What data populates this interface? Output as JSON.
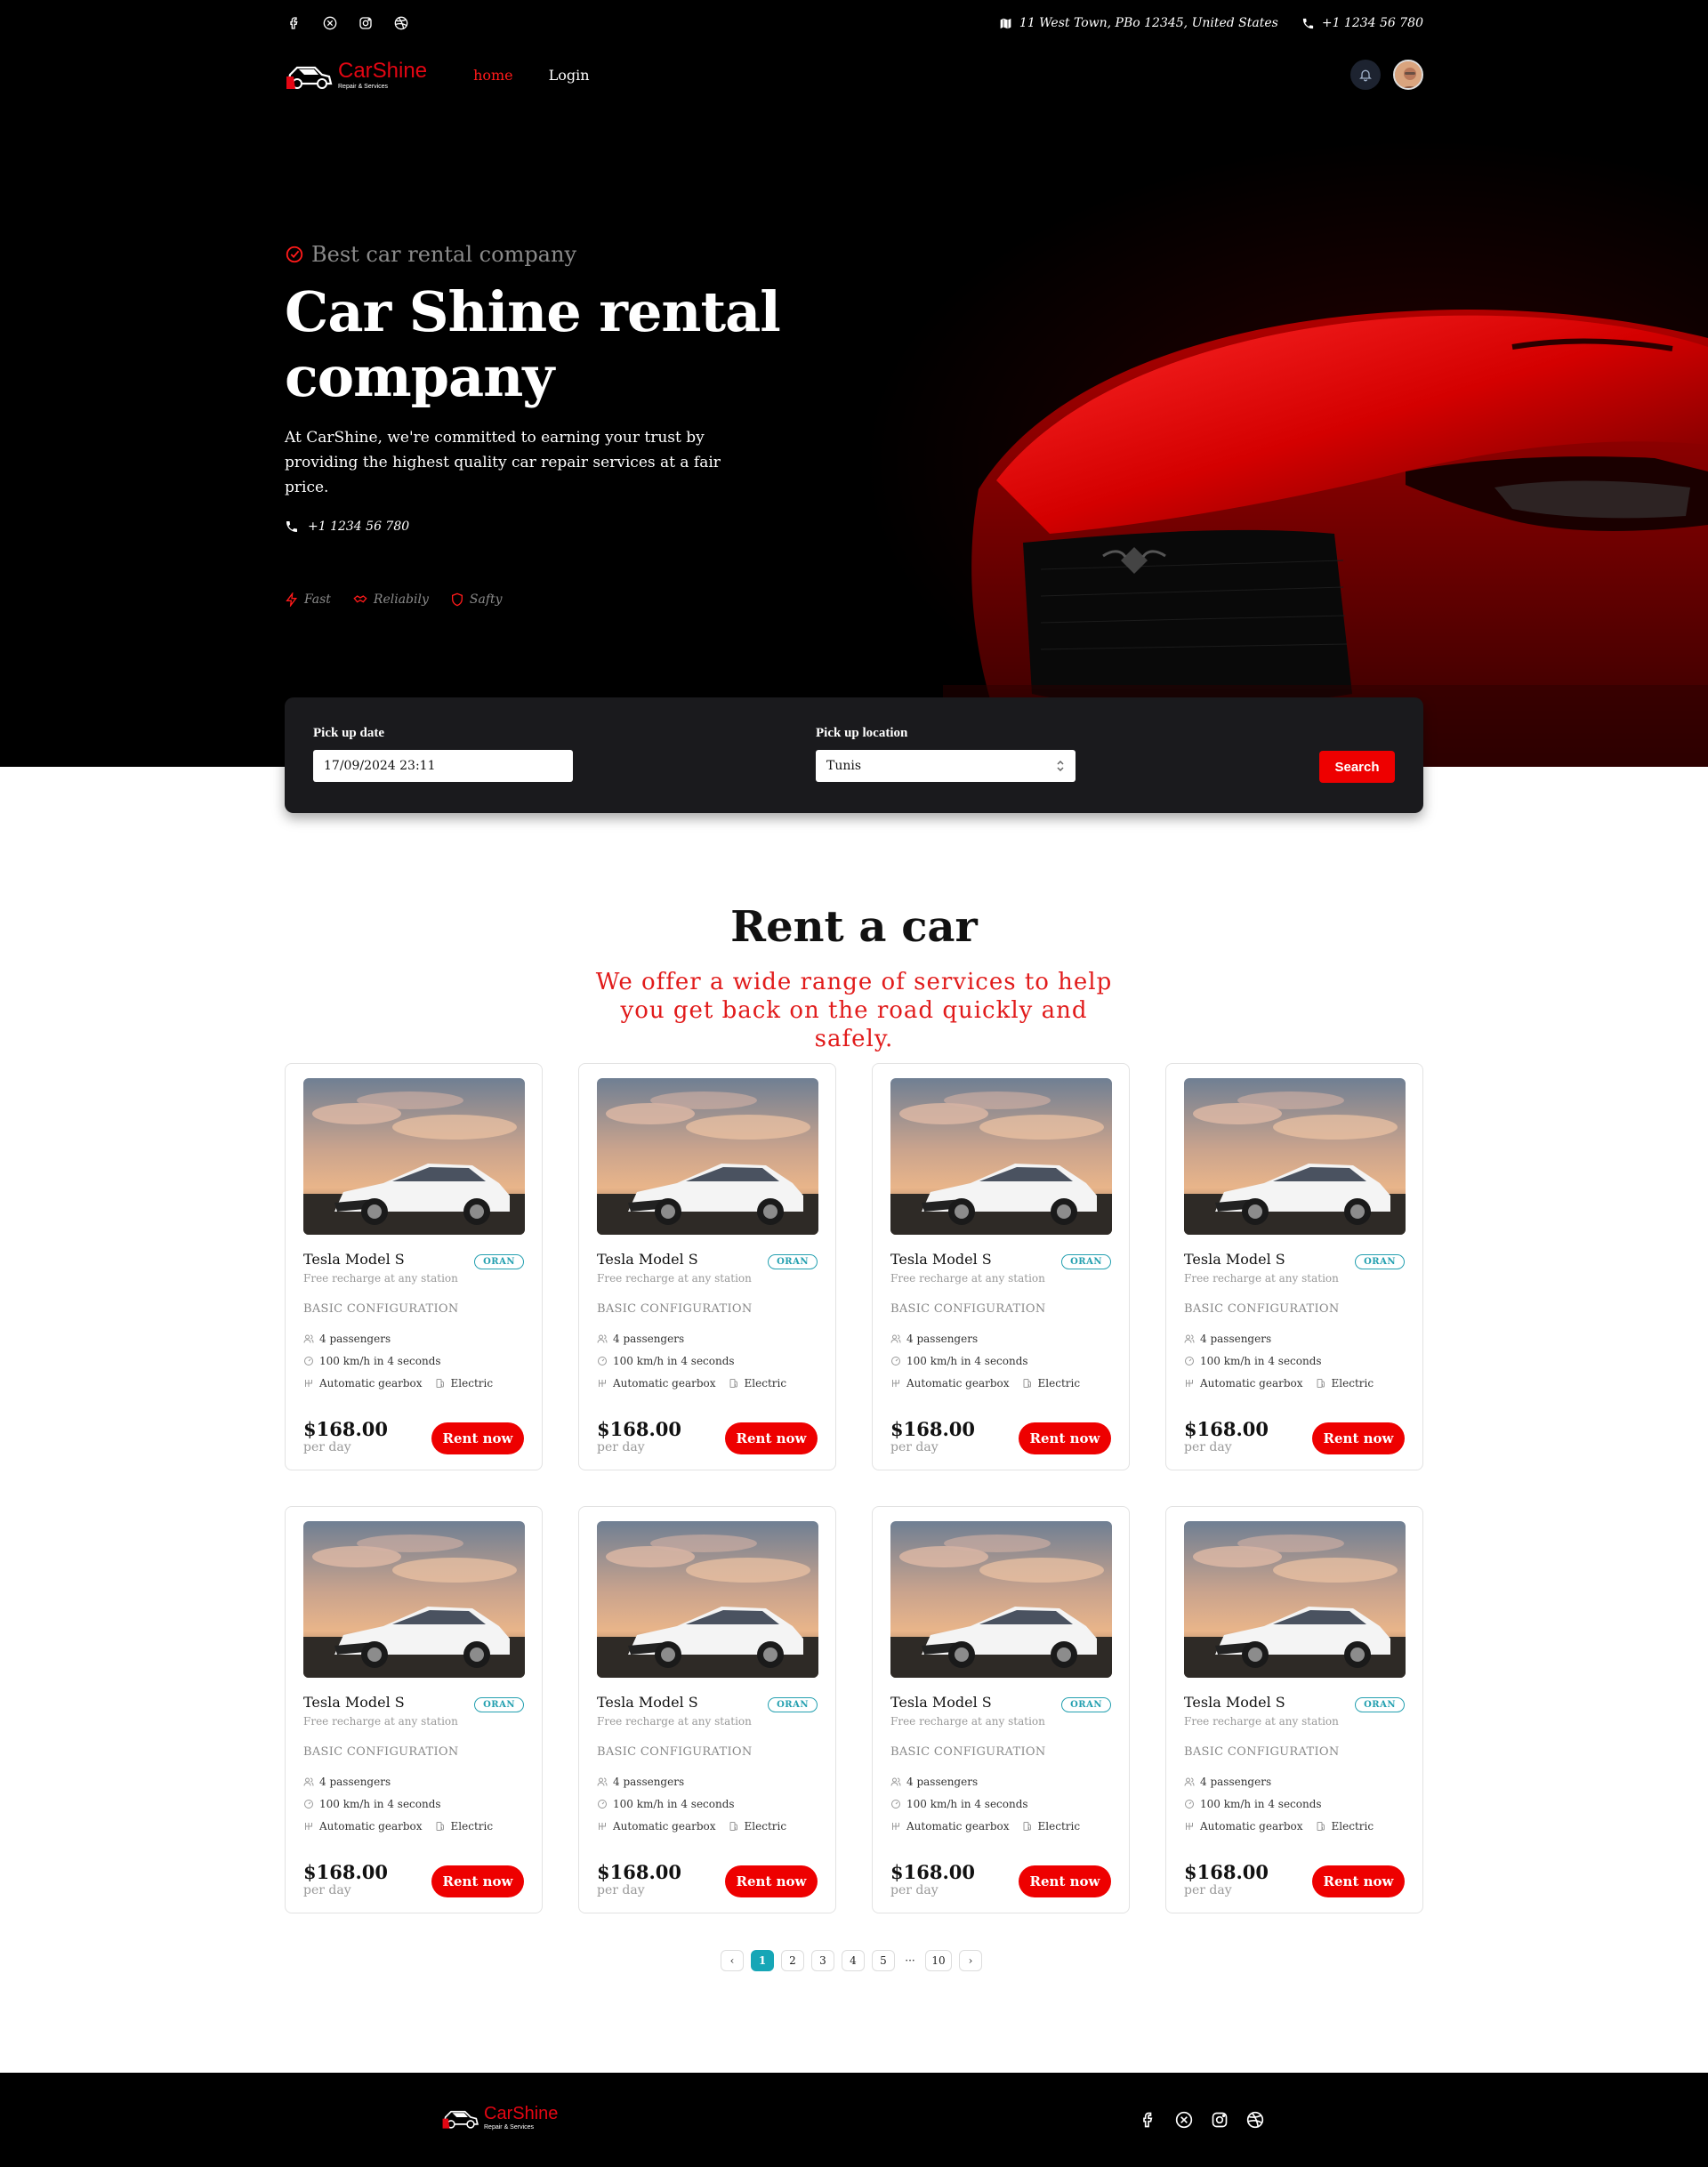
{
  "topbar": {
    "social_icons": [
      "facebook-icon",
      "x-icon",
      "instagram-icon",
      "dribbble-icon"
    ],
    "address": "11 West Town, PBo 12345, United States",
    "phone": "+1 1234 56 780"
  },
  "nav": {
    "logo_name": "CarShine",
    "logo_sub": "Repair & Services",
    "home": "home",
    "login": "Login"
  },
  "hero": {
    "tagline": "Best car rental company",
    "title": "Car Shine rental company",
    "description": "At CarShine, we're committed to earning your trust by providing the highest quality car repair services at a fair price.",
    "phone": "+1 1234 56 780",
    "features": [
      "Fast",
      "Reliabily",
      "Safty"
    ]
  },
  "search": {
    "pickup_date_label": "Pick up date",
    "pickup_date_value": "17/09/2024 23:11",
    "pickup_location_label": "Pick up location",
    "pickup_location_value": "Tunis",
    "button": "Search"
  },
  "section": {
    "title": "Rent a car",
    "subtitle": "We offer a wide range of services to help you get back on the road quickly and safely."
  },
  "cars": [
    {
      "name": "Tesla Model S",
      "badge": "ORAN",
      "tagline": "Free recharge at any station",
      "config": "BASIC CONFIGURATION",
      "passengers": "4 passengers",
      "accel": "100 km/h in 4 seconds",
      "gearbox": "Automatic gearbox",
      "fuel": "Electric",
      "price": "$168.00",
      "per": "per day",
      "cta": "Rent now"
    },
    {
      "name": "Tesla Model S",
      "badge": "ORAN",
      "tagline": "Free recharge at any station",
      "config": "BASIC CONFIGURATION",
      "passengers": "4 passengers",
      "accel": "100 km/h in 4 seconds",
      "gearbox": "Automatic gearbox",
      "fuel": "Electric",
      "price": "$168.00",
      "per": "per day",
      "cta": "Rent now"
    },
    {
      "name": "Tesla Model S",
      "badge": "ORAN",
      "tagline": "Free recharge at any station",
      "config": "BASIC CONFIGURATION",
      "passengers": "4 passengers",
      "accel": "100 km/h in 4 seconds",
      "gearbox": "Automatic gearbox",
      "fuel": "Electric",
      "price": "$168.00",
      "per": "per day",
      "cta": "Rent now"
    },
    {
      "name": "Tesla Model S",
      "badge": "ORAN",
      "tagline": "Free recharge at any station",
      "config": "BASIC CONFIGURATION",
      "passengers": "4 passengers",
      "accel": "100 km/h in 4 seconds",
      "gearbox": "Automatic gearbox",
      "fuel": "Electric",
      "price": "$168.00",
      "per": "per day",
      "cta": "Rent now"
    },
    {
      "name": "Tesla Model S",
      "badge": "ORAN",
      "tagline": "Free recharge at any station",
      "config": "BASIC CONFIGURATION",
      "passengers": "4 passengers",
      "accel": "100 km/h in 4 seconds",
      "gearbox": "Automatic gearbox",
      "fuel": "Electric",
      "price": "$168.00",
      "per": "per day",
      "cta": "Rent now"
    },
    {
      "name": "Tesla Model S",
      "badge": "ORAN",
      "tagline": "Free recharge at any station",
      "config": "BASIC CONFIGURATION",
      "passengers": "4 passengers",
      "accel": "100 km/h in 4 seconds",
      "gearbox": "Automatic gearbox",
      "fuel": "Electric",
      "price": "$168.00",
      "per": "per day",
      "cta": "Rent now"
    },
    {
      "name": "Tesla Model S",
      "badge": "ORAN",
      "tagline": "Free recharge at any station",
      "config": "BASIC CONFIGURATION",
      "passengers": "4 passengers",
      "accel": "100 km/h in 4 seconds",
      "gearbox": "Automatic gearbox",
      "fuel": "Electric",
      "price": "$168.00",
      "per": "per day",
      "cta": "Rent now"
    },
    {
      "name": "Tesla Model S",
      "badge": "ORAN",
      "tagline": "Free recharge at any station",
      "config": "BASIC CONFIGURATION",
      "passengers": "4 passengers",
      "accel": "100 km/h in 4 seconds",
      "gearbox": "Automatic gearbox",
      "fuel": "Electric",
      "price": "$168.00",
      "per": "per day",
      "cta": "Rent now"
    }
  ],
  "pagination": {
    "prev": "‹",
    "pages": [
      "1",
      "2",
      "3",
      "4",
      "5"
    ],
    "ellipsis": "···",
    "last": "10",
    "next": "›",
    "current": "1"
  },
  "footer": {
    "logo_name": "CarShine",
    "logo_sub": "Repair & Services",
    "social_icons": [
      "facebook-icon",
      "x-icon",
      "instagram-icon",
      "dribbble-icon"
    ]
  },
  "colors": {
    "accent": "#ee0000",
    "badge": "#24a0b0",
    "page_active": "#16a6b6",
    "hero_bg": "#000000",
    "search_bg": "#1a1a1d"
  }
}
